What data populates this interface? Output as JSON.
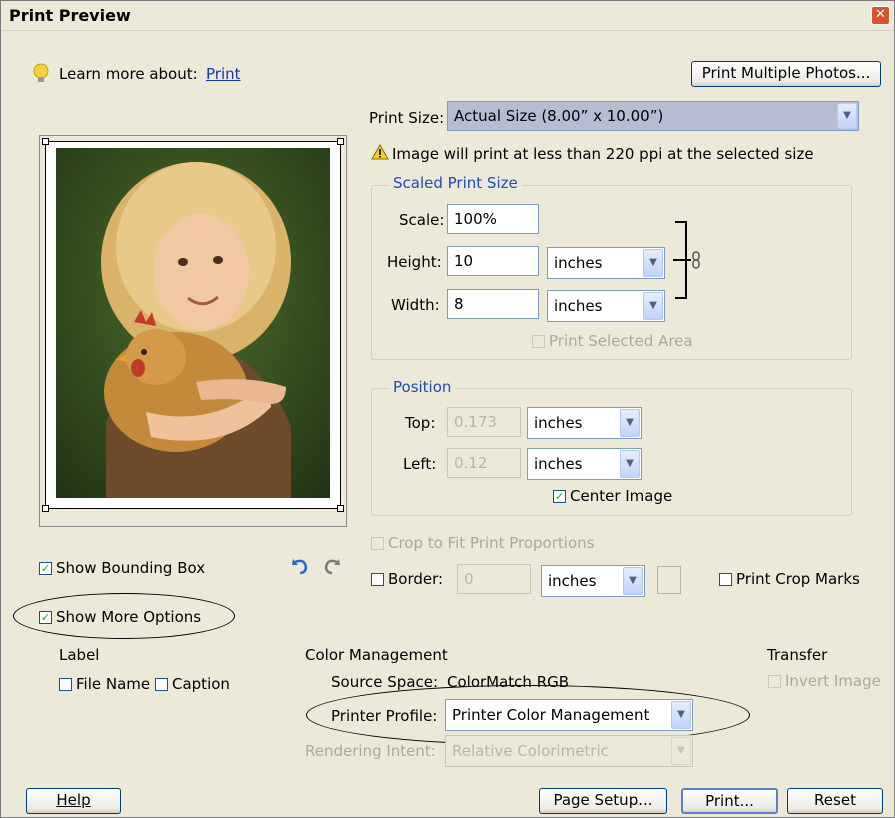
{
  "window": {
    "title": "Print Preview"
  },
  "header": {
    "learn_more": "Learn more about:",
    "learn_more_link": "Print",
    "print_multiple": "Print Multiple Photos..."
  },
  "print_size": {
    "label": "Print Size:",
    "value": "Actual Size (8.00” x 10.00”)",
    "warning": "Image will print at less than 220 ppi at the selected size"
  },
  "scaled": {
    "legend": "Scaled Print Size",
    "scale_label": "Scale:",
    "scale_value": "100%",
    "height_label": "Height:",
    "height_value": "10",
    "height_unit": "inches",
    "width_label": "Width:",
    "width_value": "8",
    "width_unit": "inches",
    "print_selected": "Print Selected Area"
  },
  "position": {
    "legend": "Position",
    "top_label": "Top:",
    "top_value": "0.173",
    "top_unit": "inches",
    "left_label": "Left:",
    "left_value": "0.12",
    "left_unit": "inches",
    "center_image": "Center Image"
  },
  "crop": {
    "label": "Crop to Fit Print Proportions"
  },
  "border": {
    "label": "Border:",
    "value": "0",
    "unit": "inches"
  },
  "print_crop_marks": "Print Crop Marks",
  "left": {
    "show_bounding_box": "Show Bounding Box",
    "show_more_options": "Show More Options"
  },
  "label_section": {
    "title": "Label",
    "file_name": "File Name",
    "caption": "Caption"
  },
  "color": {
    "title": "Color Management",
    "source_label": "Source Space:",
    "source_value": "ColorMatch RGB",
    "printer_profile_label": "Printer Profile:",
    "printer_profile_value": "Printer Color Management",
    "rendering_label": "Rendering Intent:",
    "rendering_value": "Relative Colorimetric"
  },
  "transfer": {
    "title": "Transfer",
    "invert": "Invert Image"
  },
  "footer": {
    "help": "Help",
    "page_setup": "Page Setup...",
    "print": "Print...",
    "reset": "Reset"
  }
}
